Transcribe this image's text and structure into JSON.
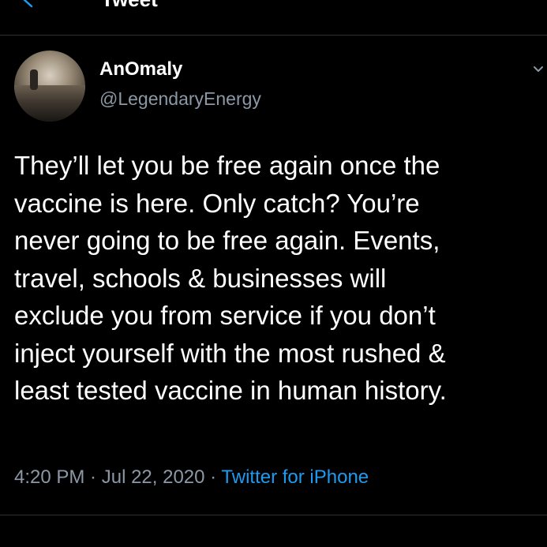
{
  "header": {
    "title": "Tweet",
    "back_icon": "chevron-left-icon"
  },
  "author": {
    "display_name": "AnOmaly",
    "handle": "@LegendaryEnergy",
    "avatar": "avatar-image"
  },
  "tweet": {
    "lines": [
      "They’ll let you be free again once the",
      "vaccine is here. Only catch? You’re",
      "never going to be free again. Events,",
      "travel, schools & businesses will",
      "exclude you from service if you don’t",
      "inject yourself with the most rushed &",
      "least tested vaccine in human history."
    ]
  },
  "meta": {
    "time": "4:20 PM",
    "separator": " · ",
    "date": "Jul 22, 2020",
    "source": "Twitter for iPhone"
  },
  "colors": {
    "background": "#000000",
    "text": "#ffffff",
    "secondary": "#8b98a5",
    "link": "#1d9bf0",
    "divider": "#2f3336"
  }
}
